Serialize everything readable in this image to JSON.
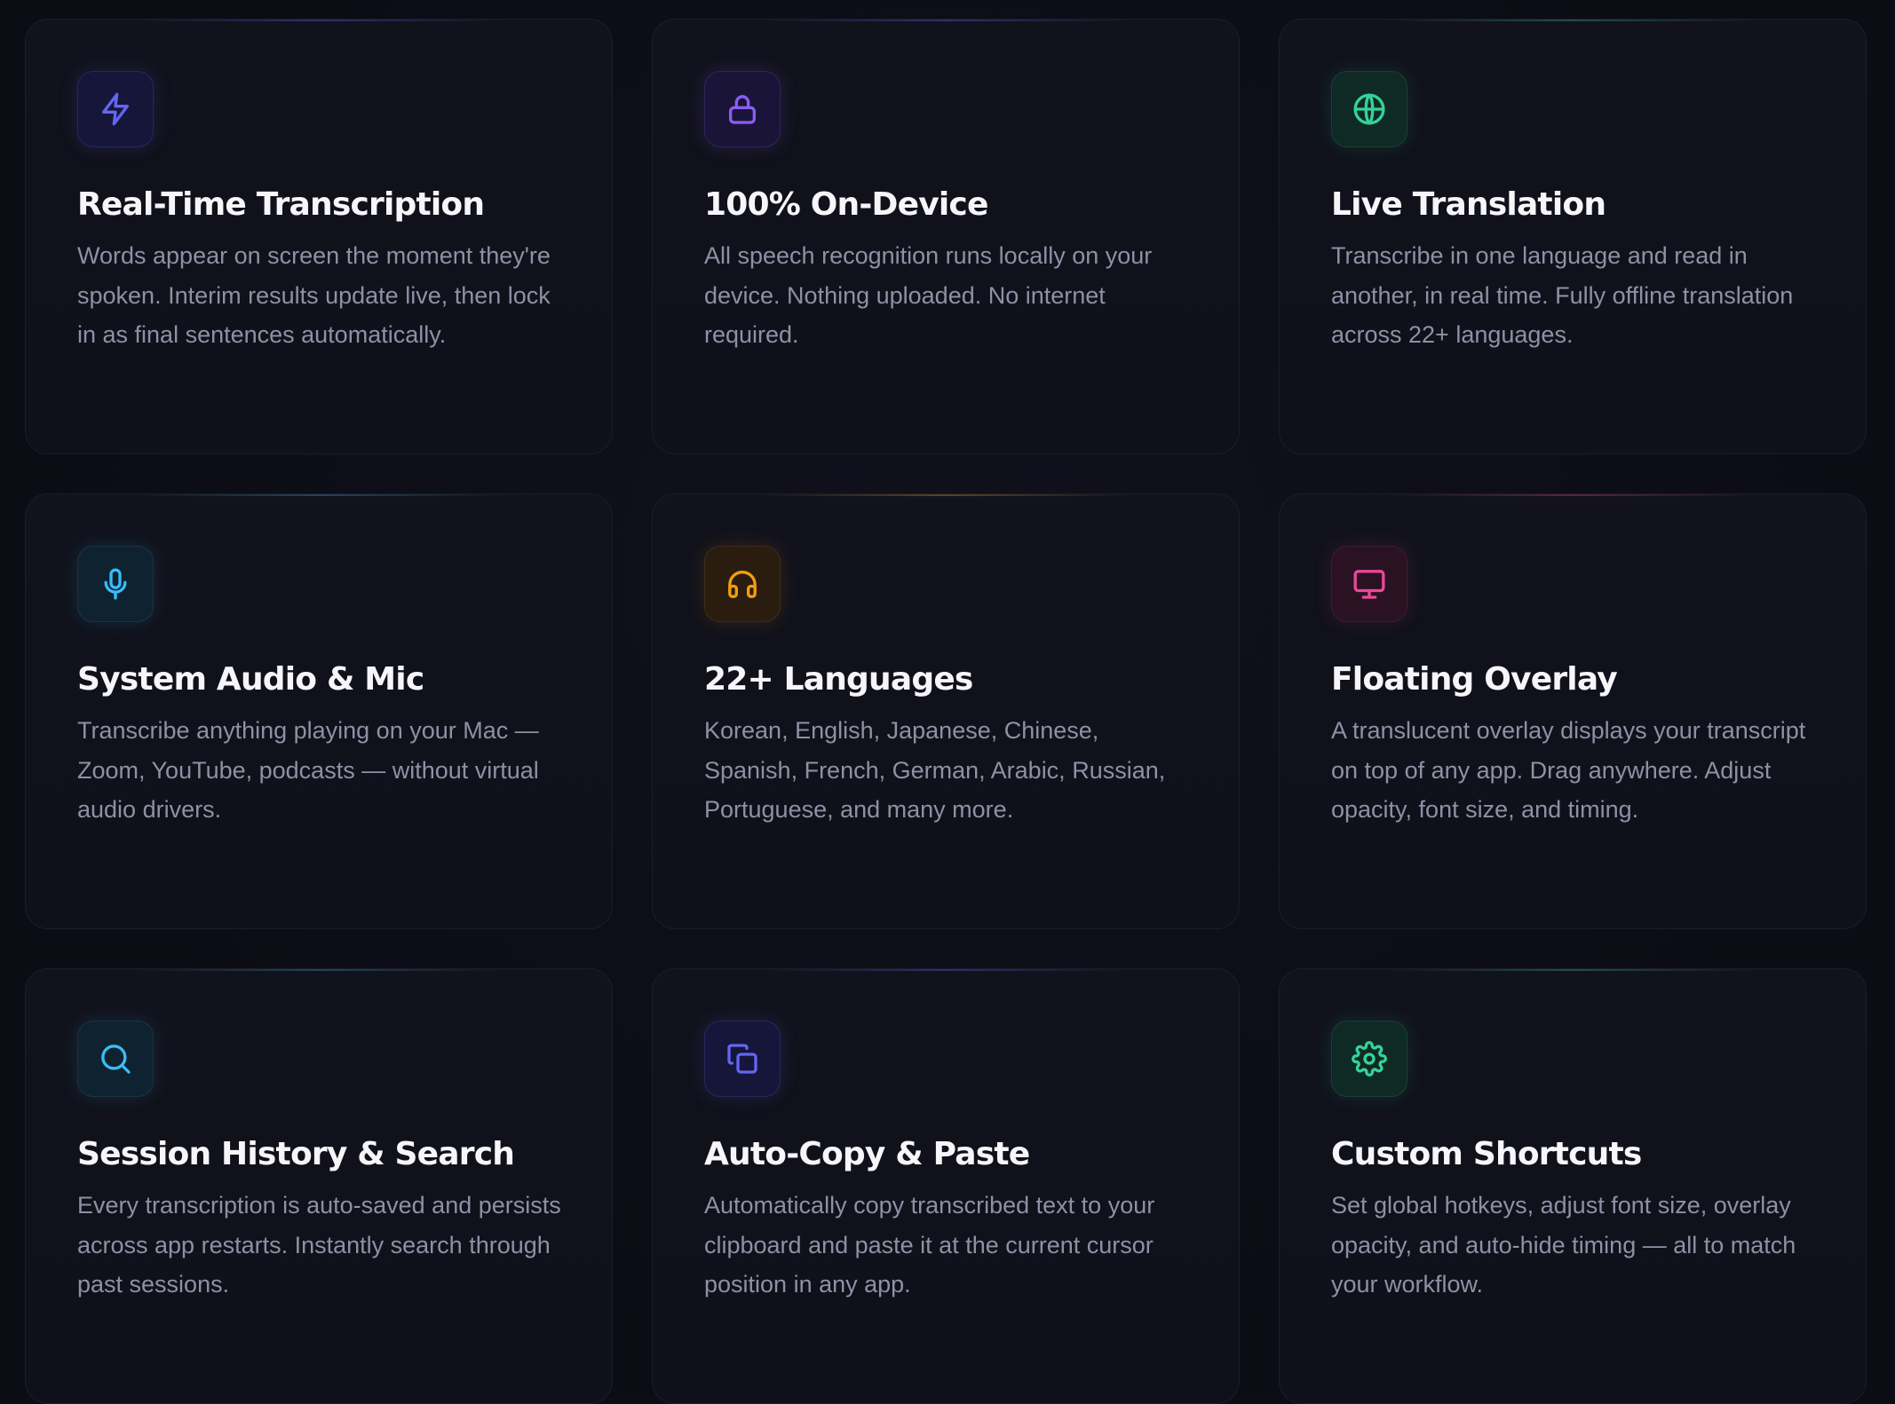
{
  "features": [
    {
      "id": "real-time-transcription",
      "title": "Real-Time Transcription",
      "description": "Words appear on screen the moment they're spoken. Interim results update live, then lock in as final sentences automatically.",
      "icon": "lightning-icon",
      "color": "#6366f1"
    },
    {
      "id": "on-device",
      "title": "100% On-Device",
      "description": "All speech recognition runs locally on your device. Nothing uploaded. No internet required.",
      "icon": "lock-icon",
      "color": "#8b5cf6"
    },
    {
      "id": "live-translation",
      "title": "Live Translation",
      "description": "Transcribe in one language and read in another, in real time. Fully offline translation across 22+ languages.",
      "icon": "globe-icon",
      "color": "#34d399"
    },
    {
      "id": "system-audio-mic",
      "title": "System Audio & Mic",
      "description": "Transcribe anything playing on your Mac — Zoom, YouTube, podcasts — without virtual audio drivers.",
      "icon": "microphone-icon",
      "color": "#38bdf8"
    },
    {
      "id": "languages",
      "title": "22+ Languages",
      "description": "Korean, English, Japanese, Chinese, Spanish, French, German, Arabic, Russian, Portuguese, and many more.",
      "icon": "headphones-icon",
      "color": "#f59e0b"
    },
    {
      "id": "floating-overlay",
      "title": "Floating Overlay",
      "description": "A translucent overlay displays your transcript on top of any app. Drag anywhere. Adjust opacity, font size, and timing.",
      "icon": "monitor-icon",
      "color": "#ec4899"
    },
    {
      "id": "session-history-search",
      "title": "Session History & Search",
      "description": "Every transcription is auto-saved and persists across app restarts. Instantly search through past sessions.",
      "icon": "search-icon",
      "color": "#38bdf8"
    },
    {
      "id": "auto-copy-paste",
      "title": "Auto-Copy & Paste",
      "description": "Automatically copy transcribed text to your clipboard and paste it at the current cursor position in any app.",
      "icon": "copy-icon",
      "color": "#6366f1"
    },
    {
      "id": "custom-shortcuts",
      "title": "Custom Shortcuts",
      "description": "Set global hotkeys, adjust font size, overlay opacity, and auto-hide timing — all to match your workflow.",
      "icon": "gear-icon",
      "color": "#34d399"
    }
  ]
}
